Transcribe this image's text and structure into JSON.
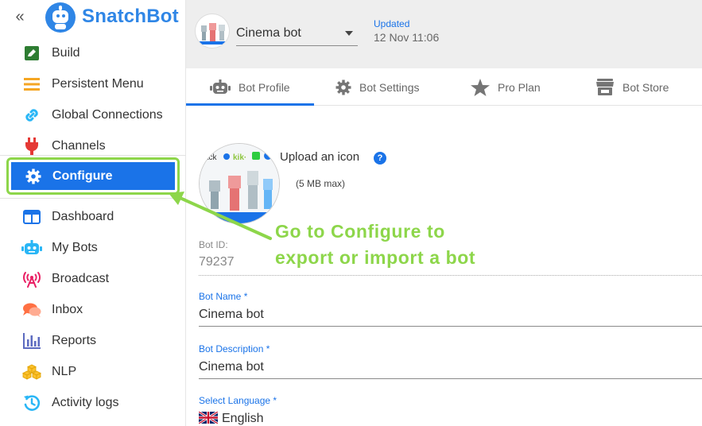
{
  "sidebar": {
    "collapse_icon": "double-chevron-left-icon",
    "brand": "SnatchBot",
    "items_top": [
      {
        "label": "Build",
        "icon": "pencil-square-icon",
        "color": "#2e7d32"
      },
      {
        "label": "Persistent Menu",
        "icon": "menu-lines-icon",
        "color": "#f5a623"
      },
      {
        "label": "Global Connections",
        "icon": "link-icon",
        "color": "#29b6f6"
      },
      {
        "label": "Channels",
        "icon": "plug-icon",
        "color": "#e53935"
      }
    ],
    "active_item": {
      "label": "Configure",
      "icon": "gear-icon"
    },
    "items_bottom": [
      {
        "label": "Dashboard",
        "icon": "dashboard-icon",
        "color": "#1a73e8"
      },
      {
        "label": "My Bots",
        "icon": "robot-icon",
        "color": "#29b6f6"
      },
      {
        "label": "Broadcast",
        "icon": "antenna-icon",
        "color": "#e91e63"
      },
      {
        "label": "Inbox",
        "icon": "chat-bubbles-icon",
        "color": "#ff7043"
      },
      {
        "label": "Reports",
        "icon": "bar-chart-icon",
        "color": "#5c6bc0"
      },
      {
        "label": "NLP",
        "icon": "cubes-icon",
        "color": "#fbc02d"
      },
      {
        "label": "Activity logs",
        "icon": "history-icon",
        "color": "#29b6f6"
      }
    ]
  },
  "header": {
    "bot_name": "Cinema bot",
    "updated_label": "Updated",
    "updated_time": "12 Nov 11:06"
  },
  "tabs": [
    {
      "label": "Bot Profile",
      "icon": "robot-icon",
      "active": true
    },
    {
      "label": "Bot Settings",
      "icon": "gear-icon",
      "active": false
    },
    {
      "label": "Pro Plan",
      "icon": "star-icon",
      "active": false
    },
    {
      "label": "Bot Store",
      "icon": "store-icon",
      "active": false
    }
  ],
  "profile": {
    "upload_label": "Upload an icon",
    "upload_hint": "(5 MB max)",
    "bot_id_label": "Bot ID:",
    "bot_id_value": "79237",
    "bot_name_label": "Bot Name *",
    "bot_name_value": "Cinema bot",
    "bot_description_label": "Bot Description *",
    "bot_description_value": "Cinema bot",
    "language_label": "Select Language *",
    "language_value": "English"
  },
  "annotation": {
    "line1": "Go to Configure to",
    "line2": "export or import a bot",
    "color": "#8dd64a"
  },
  "colors": {
    "accent": "#1a73e8",
    "brand": "#2f86e6",
    "annotation": "#8dd64a"
  }
}
